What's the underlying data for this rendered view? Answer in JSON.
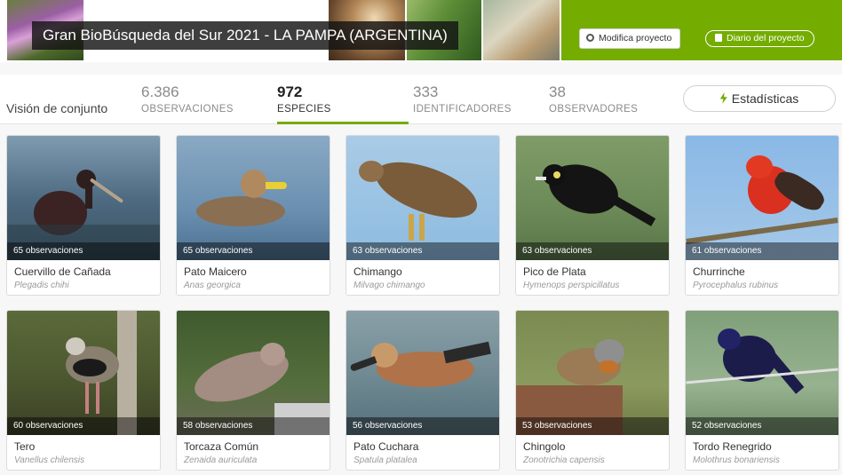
{
  "banner": {
    "title": "Gran BioBúsqueda del Sur 2021 - LA PAMPA (ARGENTINA)",
    "edit_label": "Modifica proyecto",
    "journal_label": "Diario del proyecto",
    "accent_color": "#74ac00"
  },
  "stats": {
    "overview_label": "Visión de conjunto",
    "items": [
      {
        "number": "6.386",
        "label": "OBSERVACIONES"
      },
      {
        "number": "972",
        "label": "ESPECIES"
      },
      {
        "number": "333",
        "label": "IDENTIFICADORES"
      },
      {
        "number": "38",
        "label": "OBSERVADORES"
      }
    ],
    "active_tab": "ESPECIES",
    "stats_button_label": "Estadísticas"
  },
  "species": [
    {
      "name": "Cuervillo de Cañada",
      "scientific": "Plegadis chihi",
      "observations": "65 observaciones",
      "icon": "ibis-photo"
    },
    {
      "name": "Pato Maicero",
      "scientific": "Anas georgica",
      "observations": "65 observaciones",
      "icon": "duck-photo"
    },
    {
      "name": "Chimango",
      "scientific": "Milvago chimango",
      "observations": "63 observaciones",
      "icon": "caracara-photo"
    },
    {
      "name": "Pico de Plata",
      "scientific": "Hymenops perspicillatus",
      "observations": "63 observaciones",
      "icon": "tyrant-photo"
    },
    {
      "name": "Churrinche",
      "scientific": "Pyrocephalus rubinus",
      "observations": "61 observaciones",
      "icon": "flycatcher-photo"
    },
    {
      "name": "Tero",
      "scientific": "Vanellus chilensis",
      "observations": "60 observaciones",
      "icon": "lapwing-photo"
    },
    {
      "name": "Torcaza Común",
      "scientific": "Zenaida auriculata",
      "observations": "58 observaciones",
      "icon": "dove-photo"
    },
    {
      "name": "Pato Cuchara",
      "scientific": "Spatula platalea",
      "observations": "56 observaciones",
      "icon": "shoveler-photo"
    },
    {
      "name": "Chingolo",
      "scientific": "Zonotrichia capensis",
      "observations": "53 observaciones",
      "icon": "sparrow-photo"
    },
    {
      "name": "Tordo Renegrido",
      "scientific": "Molothrus bonariensis",
      "observations": "52 observaciones",
      "icon": "cowbird-photo"
    }
  ]
}
